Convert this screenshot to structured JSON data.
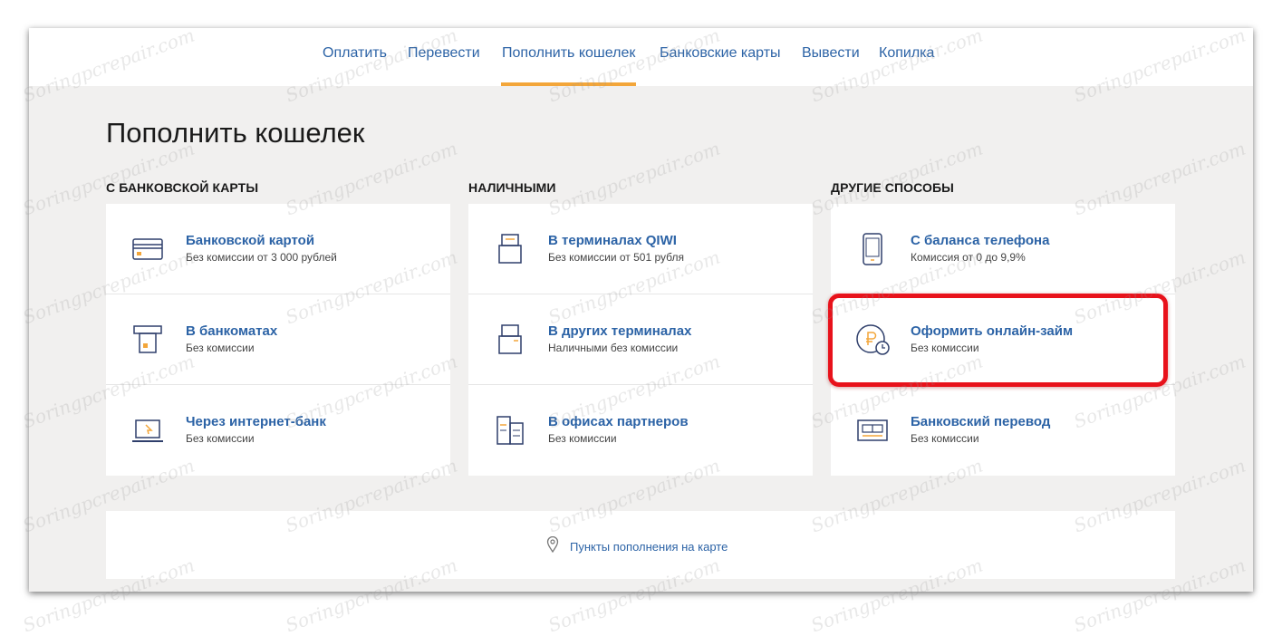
{
  "nav": {
    "items": [
      {
        "label": "Оплатить",
        "active": false
      },
      {
        "label": "Перевести",
        "active": false
      },
      {
        "label": "Пополнить кошелек",
        "active": true
      },
      {
        "label": "Банковские карты",
        "active": false
      },
      {
        "label": "Вывести",
        "active": false
      },
      {
        "label": "Копилка",
        "active": false
      }
    ]
  },
  "page": {
    "title": "Пополнить кошелек"
  },
  "sections": [
    {
      "title": "С БАНКОВСКОЙ КАРТЫ",
      "items": [
        {
          "title": "Банковской картой",
          "subtitle": "Без комиссии от 3 000 рублей",
          "icon": "bank-card-icon"
        },
        {
          "title": "В банкоматах",
          "subtitle": "Без комиссии",
          "icon": "atm-icon"
        },
        {
          "title": "Через интернет-банк",
          "subtitle": "Без комиссии",
          "icon": "laptop-icon"
        }
      ]
    },
    {
      "title": "НАЛИЧНЫМИ",
      "items": [
        {
          "title": "В терминалах QIWI",
          "subtitle": "Без комиссии от 501 рубля",
          "icon": "qiwi-terminal-icon"
        },
        {
          "title": "В других терминалах",
          "subtitle": "Наличными без комиссии",
          "icon": "terminal-icon"
        },
        {
          "title": "В офисах партнеров",
          "subtitle": "Без комиссии",
          "icon": "office-icon"
        }
      ]
    },
    {
      "title": "ДРУГИЕ СПОСОБЫ",
      "items": [
        {
          "title": "С баланса телефона",
          "subtitle": "Комиссия от 0 до 9,9%",
          "icon": "phone-icon"
        },
        {
          "title": "Оформить онлайн-займ",
          "subtitle": "Без комиссии",
          "icon": "ruble-clock-icon"
        },
        {
          "title": "Банковский перевод",
          "subtitle": "Без комиссии",
          "icon": "bank-transfer-icon"
        }
      ]
    }
  ],
  "map_link": {
    "label": "Пункты пополнения на карте",
    "icon": "map-pin-icon"
  },
  "colors": {
    "link": "#2c63a6",
    "accent": "#f3a63a",
    "highlight": "#e8121b",
    "icon_orange": "#f3a63a"
  },
  "watermark": "Soringpcrepair.com"
}
